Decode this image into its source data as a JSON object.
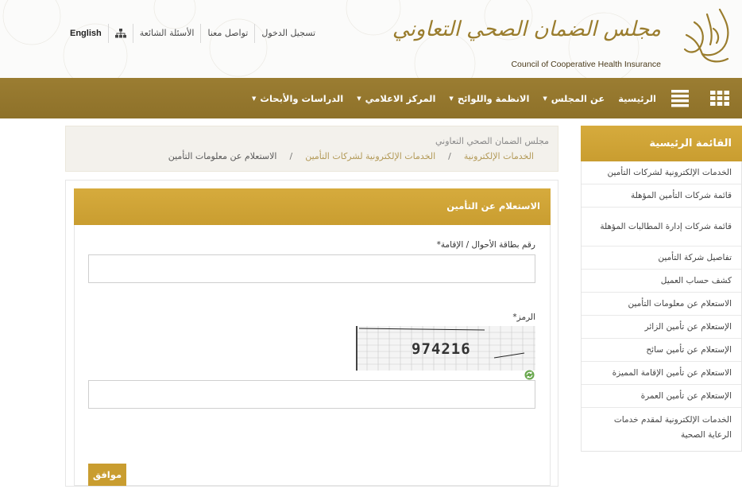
{
  "header": {
    "logo_text_ar": "مجلس الضمان الصحي التعاوني",
    "logo_text_en": "Council of Cooperative Health Insurance",
    "links": [
      {
        "label": "English"
      },
      {
        "label": "",
        "icon": "sitemap-icon"
      },
      {
        "label": "الأسئلة الشائعة"
      },
      {
        "label": "تواصل معنا"
      },
      {
        "label": "تسجيل الدخول"
      }
    ]
  },
  "nav": {
    "items": [
      {
        "label": "الرئيسية",
        "dropdown": false
      },
      {
        "label": "عن المجلس",
        "dropdown": true
      },
      {
        "label": "الانظمة واللوائح",
        "dropdown": true
      },
      {
        "label": "المركز الاعلامي",
        "dropdown": true
      },
      {
        "label": "الدراسات والأبحاث",
        "dropdown": true
      }
    ]
  },
  "breadcrumb": {
    "title": "مجلس الضمان الصحي التعاوني",
    "items": [
      "الخدمات الإلكترونية",
      "الخدمات الإلكترونية لشركات التأمين",
      "الاستعلام عن معلومات التأمين"
    ],
    "separator": "/"
  },
  "form": {
    "title": "الاستعلام عن التأمين",
    "id_label": "رقم بطاقة الأحوال / الإقامة*",
    "id_value": "",
    "captcha_label": "الرمز*",
    "captcha_text": "974216",
    "captcha_value": "",
    "submit_label": "موافق"
  },
  "sidebar": {
    "title": "القائمة الرئيسية",
    "items": [
      "الخدمات الإلكترونية لشركات التأمين",
      "قائمة شركات التأمين المؤهلة",
      "قائمة شركات إدارة المطالبات المؤهلة",
      "تفاصيل شركة التأمين",
      "كشف حساب العميل",
      "الاستعلام عن معلومات التأمين",
      "الإستعلام عن تأمين الزائر",
      "الإستعلام عن تأمين سائح",
      "الاستعلام عن تأمين الإقامة المميزة",
      "الإستعلام عن تأمين العمرة",
      "الخدمات الإلكترونية لمقدم خدمات الرعاية الصحية"
    ]
  },
  "colors": {
    "gold": "#c99d30",
    "nav_brown": "#957830",
    "crumb_link": "#b39a58"
  }
}
